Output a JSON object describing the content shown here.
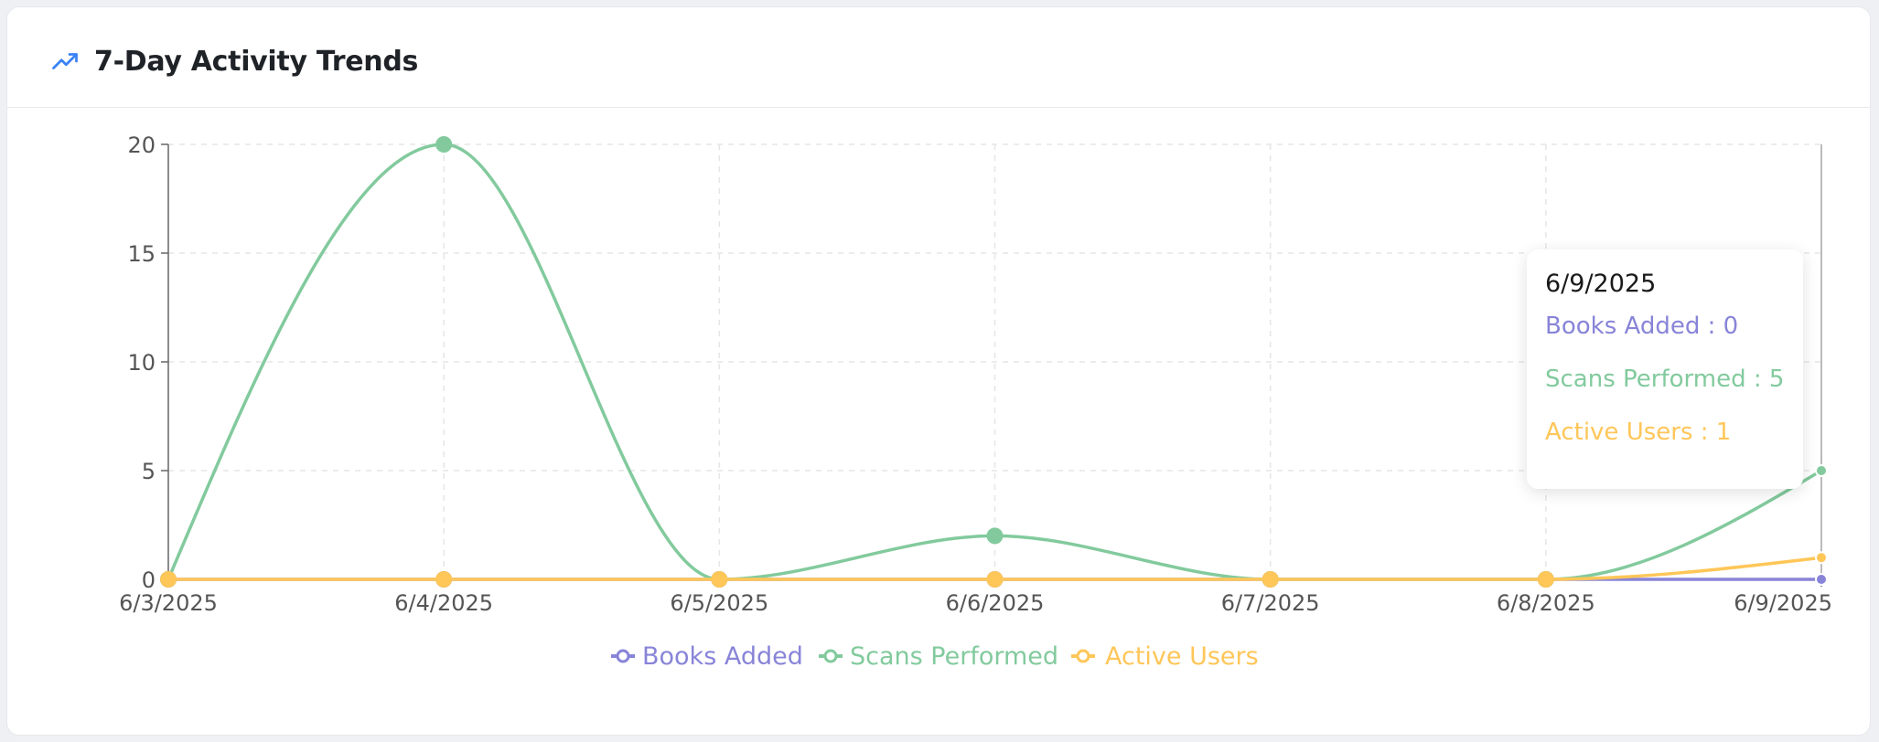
{
  "card": {
    "title": "7-Day Activity Trends",
    "icon": "trending-up-icon"
  },
  "chart_data": {
    "type": "line",
    "title": "7-Day Activity Trends",
    "categories": [
      "6/3/2025",
      "6/4/2025",
      "6/5/2025",
      "6/6/2025",
      "6/7/2025",
      "6/8/2025",
      "6/9/2025"
    ],
    "yticks": [
      0,
      5,
      10,
      15,
      20
    ],
    "ylim": [
      0,
      20
    ],
    "grid": true,
    "legend_position": "bottom-center",
    "series": [
      {
        "name": "Books Added",
        "color": "#8884d8",
        "values": [
          0,
          0,
          0,
          0,
          0,
          0,
          0
        ]
      },
      {
        "name": "Scans Performed",
        "color": "#82ca9d",
        "values": [
          0,
          20,
          0,
          2,
          0,
          0,
          5
        ]
      },
      {
        "name": "Active Users",
        "color": "#ffc658",
        "values": [
          0,
          0,
          0,
          0,
          0,
          0,
          1
        ]
      }
    ]
  },
  "tooltip": {
    "label": "6/9/2025",
    "rows": [
      {
        "text": "Books Added : 0",
        "color": "#8884d8"
      },
      {
        "text": "Scans Performed : 5",
        "color": "#82ca9d"
      },
      {
        "text": "Active Users : 1",
        "color": "#ffc658"
      }
    ]
  }
}
